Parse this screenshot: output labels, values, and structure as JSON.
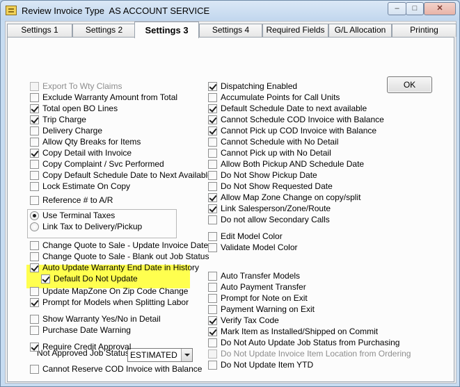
{
  "window": {
    "title": "Review Invoice Type  AS ACCOUNT SERVICE"
  },
  "tabs": [
    {
      "label": "Settings 1",
      "active": false
    },
    {
      "label": "Settings 2",
      "active": false
    },
    {
      "label": "Settings 3",
      "active": true
    },
    {
      "label": "Settings 4",
      "active": false
    },
    {
      "label": "Required Fields",
      "active": false
    },
    {
      "label": "G/L Allocation",
      "active": false
    },
    {
      "label": "Printing",
      "active": false
    }
  ],
  "ok_label": "OK",
  "left_column": [
    {
      "label": "Export To Wty Claims",
      "checked": false,
      "disabled": true
    },
    {
      "label": "Exclude Warranty Amount from Total",
      "checked": false,
      "disabled": false
    },
    {
      "label": "Total open BO Lines",
      "checked": true,
      "disabled": false
    },
    {
      "label": "Trip Charge",
      "checked": true,
      "disabled": false
    },
    {
      "label": "Delivery Charge",
      "checked": false,
      "disabled": false
    },
    {
      "label": "Allow Qty Breaks for Items",
      "checked": false,
      "disabled": false
    },
    {
      "label": "Copy Detail with Invoice",
      "checked": true,
      "disabled": false
    },
    {
      "label": "Copy Complaint / Svc Performed",
      "checked": false,
      "disabled": false
    },
    {
      "label": "Copy Default Schedule Date to Next Available",
      "checked": false,
      "disabled": false
    },
    {
      "label": "Lock Estimate On Copy",
      "checked": false,
      "disabled": false
    },
    {
      "label": "Reference # to A/R",
      "checked": false,
      "disabled": false
    },
    {
      "label": "Change Quote to Sale - Update Invoice Date",
      "checked": false,
      "disabled": false
    },
    {
      "label": "Change Quote to Sale - Blank out Job Status",
      "checked": false,
      "disabled": false
    },
    {
      "label": "Auto Update Warranty End Date in History",
      "checked": true,
      "disabled": false
    },
    {
      "label": "Default Do Not Update",
      "checked": true,
      "disabled": false
    },
    {
      "label": "Update MapZone On Zip Code Change",
      "checked": false,
      "disabled": false
    },
    {
      "label": "Prompt for Models when Splitting Labor",
      "checked": true,
      "disabled": false
    },
    {
      "label": "Show Warranty Yes/No in Detail",
      "checked": false,
      "disabled": false
    },
    {
      "label": "Purchase Date Warning",
      "checked": false,
      "disabled": false
    },
    {
      "label": "Require Credit Approval",
      "checked": true,
      "disabled": false
    },
    {
      "label": "Cannot Reserve COD Invoice with Balance",
      "checked": false,
      "disabled": false
    }
  ],
  "tax_options": [
    {
      "label": "Use Terminal Taxes",
      "selected": true
    },
    {
      "label": "Link Tax to Delivery/Pickup",
      "selected": false
    }
  ],
  "not_approved": {
    "label": "Not Approved Job Status",
    "value": "ESTIMATED"
  },
  "right_column": [
    {
      "label": "Dispatching Enabled",
      "checked": true,
      "disabled": false
    },
    {
      "label": "Accumulate Points for Call Units",
      "checked": false,
      "disabled": false
    },
    {
      "label": "Default Schedule Date to next available",
      "checked": true,
      "disabled": false
    },
    {
      "label": "Cannot Schedule COD Invoice with Balance",
      "checked": true,
      "disabled": false
    },
    {
      "label": "Cannot Pick up COD Invoice with Balance",
      "checked": true,
      "disabled": false
    },
    {
      "label": "Cannot Schedule with No Detail",
      "checked": false,
      "disabled": false
    },
    {
      "label": "Cannot Pick up with No Detail",
      "checked": false,
      "disabled": false
    },
    {
      "label": "Allow Both Pickup AND Schedule Date",
      "checked": false,
      "disabled": false
    },
    {
      "label": "Do Not Show Pickup Date",
      "checked": false,
      "disabled": false
    },
    {
      "label": "Do Not Show Requested Date",
      "checked": false,
      "disabled": false
    },
    {
      "label": "Allow Map Zone Change on copy/split",
      "checked": true,
      "disabled": false
    },
    {
      "label": "Link Salesperson/Zone/Route",
      "checked": true,
      "disabled": false
    },
    {
      "label": "Do not allow Secondary Calls",
      "checked": false,
      "disabled": false
    },
    {
      "label": "Edit Model Color",
      "checked": false,
      "disabled": false
    },
    {
      "label": "Validate Model Color",
      "checked": false,
      "disabled": false
    },
    {
      "label": "Auto Transfer Models",
      "checked": false,
      "disabled": false
    },
    {
      "label": "Auto Payment Transfer",
      "checked": false,
      "disabled": false
    },
    {
      "label": "Prompt for Note on Exit",
      "checked": false,
      "disabled": false
    },
    {
      "label": "Payment Warning on Exit",
      "checked": false,
      "disabled": false
    },
    {
      "label": "Verify Tax Code",
      "checked": true,
      "disabled": false
    },
    {
      "label": "Mark Item as Installed/Shipped on Commit",
      "checked": true,
      "disabled": false
    },
    {
      "label": "Do Not Auto Update Job Status from Purchasing",
      "checked": false,
      "disabled": false
    },
    {
      "label": "Do Not  Update Invoice Item Location from Ordering",
      "checked": false,
      "disabled": true
    },
    {
      "label": "Do Not Update Item YTD",
      "checked": false,
      "disabled": false
    }
  ],
  "highlight_color": "#ffff4f"
}
